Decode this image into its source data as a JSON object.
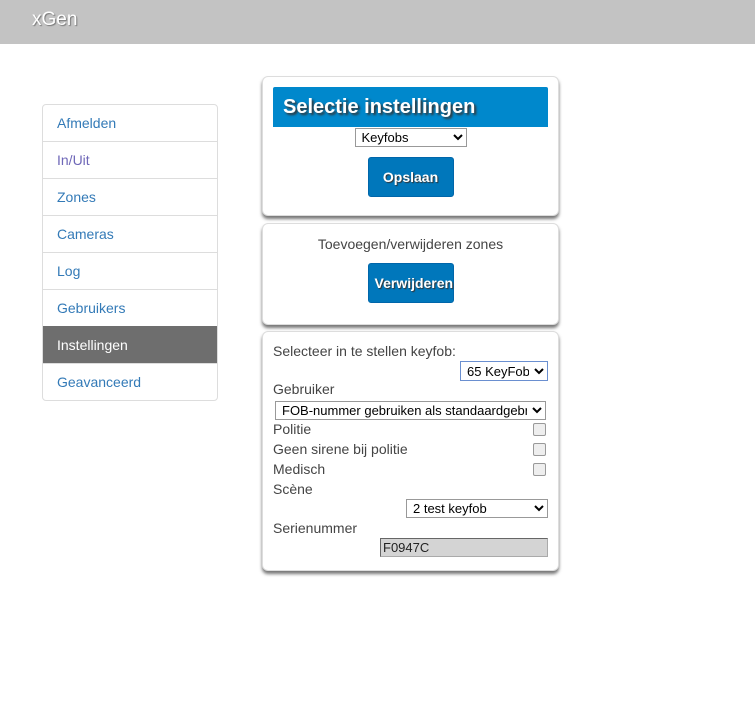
{
  "app": {
    "title": "xGen"
  },
  "nav": {
    "items": [
      "Afmelden",
      "In/Uit",
      "Zones",
      "Cameras",
      "Log",
      "Gebruikers",
      "Instellingen",
      "Geavanceerd"
    ]
  },
  "selection": {
    "title": "Selectie instellingen",
    "select_value": "Keyfobs",
    "save_label": "Opslaan"
  },
  "zones": {
    "label": "Toevoegen/verwijderen zones",
    "remove_label": "Verwijderen"
  },
  "keyfob": {
    "select_label": "Selecteer in te stellen keyfob:",
    "keyfob_value": "65 KeyFob",
    "user_label": "Gebruiker",
    "user_value": "FOB-nummer gebruiken als standaardgebr",
    "police_label": "Politie",
    "no_siren_label": "Geen sirene bij politie",
    "medical_label": "Medisch",
    "scene_label": "Scène",
    "scene_value": "2 test keyfob",
    "serial_label": "Serienummer",
    "serial_value": "F0947C"
  }
}
